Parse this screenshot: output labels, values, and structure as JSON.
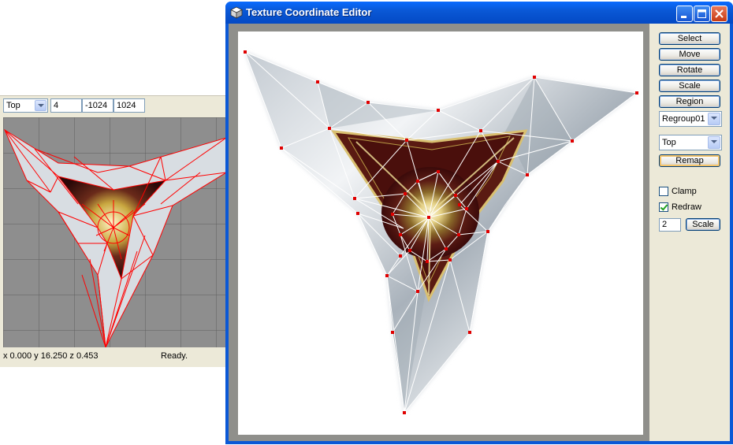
{
  "left_viewport": {
    "view_select": "Top",
    "field_value_1": "4",
    "field_value_2": "-1024",
    "field_value_3": "1024",
    "status_coords": "x 0.000 y 16.250 z 0.453",
    "status_text": "Ready."
  },
  "editor": {
    "title": "Texture Coordinate Editor",
    "buttons": {
      "select": "Select",
      "move": "Move",
      "rotate": "Rotate",
      "scale": "Scale",
      "region": "Region",
      "remap": "Remap",
      "scale_apply": "Scale"
    },
    "region_select": "Regroup01",
    "projection_select": "Top",
    "clamp_label": "Clamp",
    "clamp_checked": false,
    "redraw_label": "Redraw",
    "redraw_checked": true,
    "scale_value": "2"
  },
  "icons": [
    "cube-app-icon",
    "minimize-icon",
    "maximize-icon",
    "close-icon",
    "chevron-down-icon"
  ],
  "colors": {
    "title_bar": "#0a58d6",
    "wire_red": "#ff0000",
    "vertex_red": "#e00000",
    "canvas_bg": "#8f8f8b"
  }
}
